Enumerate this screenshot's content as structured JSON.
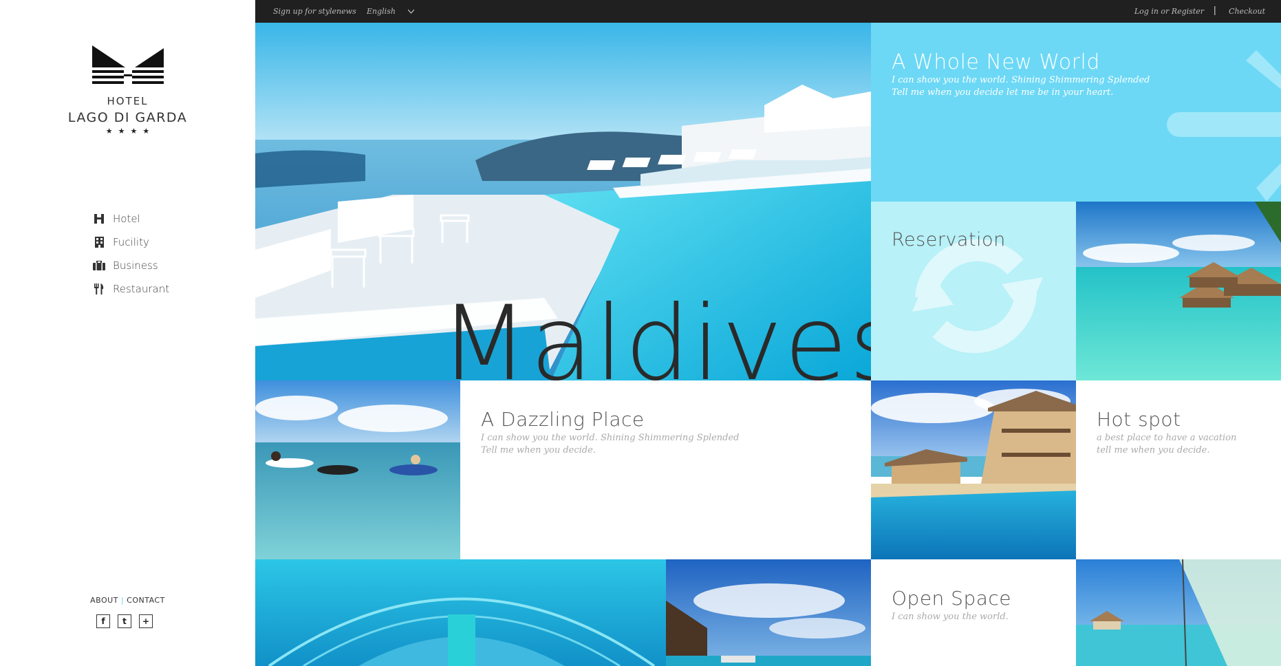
{
  "brand": {
    "hotel": "HOTEL",
    "name": "LAGO DI GARDA",
    "stars": "★★★★"
  },
  "nav": {
    "items": [
      {
        "label": "Hotel",
        "icon": "hotel-h-icon"
      },
      {
        "label": "Fucility",
        "icon": "building-icon"
      },
      {
        "label": "Business",
        "icon": "briefcase-icon"
      },
      {
        "label": "Restaurant",
        "icon": "fork-knife-icon"
      }
    ]
  },
  "footer": {
    "about": "ABOUT",
    "separator": "|",
    "contact": "CONTACT",
    "socials": [
      "f",
      "t",
      "+"
    ]
  },
  "topbar": {
    "signup": "Sign up for stylenews",
    "language": "English",
    "login": "Log in or Register",
    "separator": "|",
    "checkout": "Checkout"
  },
  "hero": {
    "word": "Maldives"
  },
  "tiles": {
    "whole_new_world": {
      "title": "A Whole New World",
      "line1": "I can show you the world. Shining Shimmering Splended",
      "line2": "Tell me when you decide let me be in your heart."
    },
    "reservation": {
      "title": "Reservation"
    },
    "dazzling": {
      "title": "A Dazzling Place",
      "line1": "I can show you the world. Shining Shimmering Splended",
      "line2": "Tell me when you decide."
    },
    "hot_spot": {
      "title": "Hot spot",
      "line1": "a best place to have a vacation",
      "line2": "tell me when you decide."
    },
    "open_space": {
      "title": "Open Space",
      "line1": "I can show you the world."
    }
  },
  "colors": {
    "topbar": "#202020",
    "cyan_tile": "#6cd8f5",
    "light_cyan_tile": "#b8f1f8",
    "accent": "#6cd0e8"
  }
}
